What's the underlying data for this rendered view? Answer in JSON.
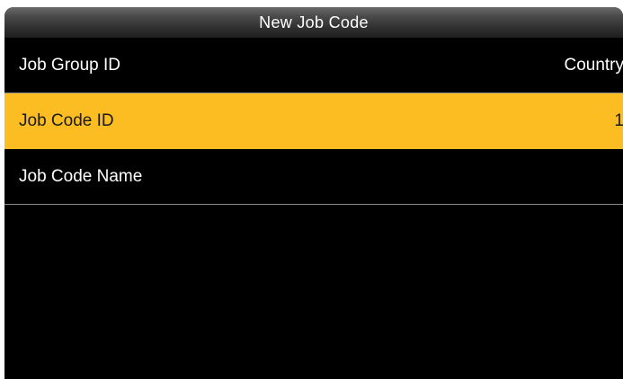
{
  "header": {
    "title": "New Job Code"
  },
  "menu": {
    "items": [
      {
        "label": "Job Group ID",
        "value": "Country"
      },
      {
        "label": "Job Code ID",
        "value": "1"
      },
      {
        "label": "Job Code Name",
        "value": ""
      }
    ],
    "selected_index": 1
  },
  "colors": {
    "background": "#000000",
    "selected_row": "#fbbd22",
    "text": "#ffffff",
    "divider": "#8a8a8a"
  }
}
